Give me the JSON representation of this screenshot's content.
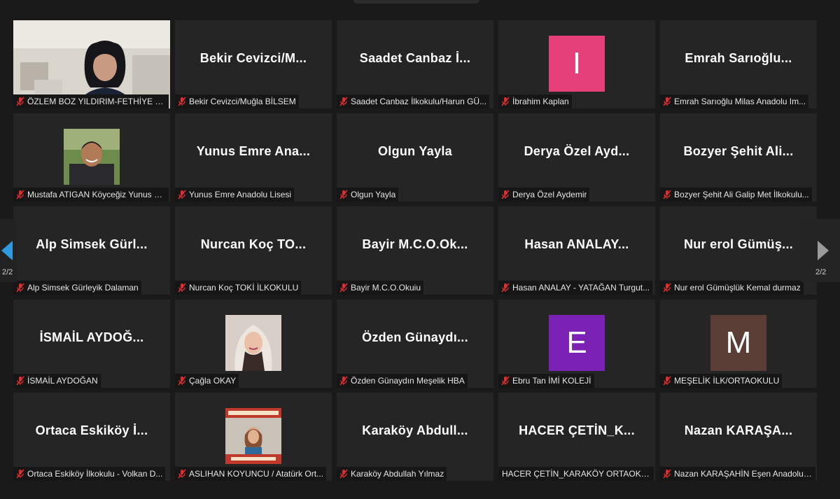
{
  "page": {
    "left_indicator": "2/2",
    "right_indicator": "2/2"
  },
  "colors": {
    "background": "#1a1a1a",
    "tile": "#252525",
    "muted_icon": "#e02d2d",
    "nav_arrow_active": "#2d9be0",
    "nav_arrow_inactive": "#9a9a9a"
  },
  "participants": [
    {
      "type": "video",
      "name": "ÖZLEM BOZ YILDIRIM-FETHİYE BE...",
      "muted": true
    },
    {
      "type": "name",
      "display": "Bekir  Cevizci/M...",
      "name": "Bekir Cevizci/Muğla BİLSEM",
      "muted": true
    },
    {
      "type": "name",
      "display": "Saadet Canbaz İ...",
      "name": "Saadet Canbaz İlkokulu/Harun GÜ...",
      "muted": true
    },
    {
      "type": "avatar",
      "initial": "I",
      "color": "#e5407a",
      "name": "İbrahim Kaplan",
      "muted": true
    },
    {
      "type": "name",
      "display": "Emrah Sarıoğlu...",
      "name": "Emrah Sarıoğlu Milas Anadolu Im...",
      "muted": true
    },
    {
      "type": "photo",
      "photo": "man",
      "name": "Mustafa ATIGAN Köyceğiz Yunus E...",
      "muted": true
    },
    {
      "type": "name",
      "display": "Yunus Emre Ana...",
      "name": "Yunus Emre Anadolu Lisesi",
      "muted": true
    },
    {
      "type": "name",
      "display": "Olgun Yayla",
      "name": "Olgun Yayla",
      "muted": true
    },
    {
      "type": "name",
      "display": "Derya Özel Ayd...",
      "name": "Derya Özel Aydemir",
      "muted": true
    },
    {
      "type": "name",
      "display": "Bozyer Şehit Ali...",
      "name": "Bozyer Şehit Ali Galip Met İlkokulu...",
      "muted": true
    },
    {
      "type": "name",
      "display": "Alp Simsek Gürl...",
      "name": "Alp Simsek Gürleyik Dalaman",
      "muted": true
    },
    {
      "type": "name",
      "display": "Nurcan Koç TO...",
      "name": "Nurcan Koç TOKİ İLKOKULU",
      "muted": true
    },
    {
      "type": "name",
      "display": "Bayir  M.C.O.Ok...",
      "name": "Bayir M.C.O.Okuiu",
      "muted": true
    },
    {
      "type": "name",
      "display": "Hasan  ANALAY...",
      "name": "Hasan ANALAY - YATAĞAN Turgut...",
      "muted": true
    },
    {
      "type": "name",
      "display": "Nur erol Gümüş...",
      "name": "Nur erol Gümüşlük Kemal durmaz",
      "muted": true
    },
    {
      "type": "name",
      "display": "İSMAİL  AYDOĞ...",
      "name": "İSMAİL AYDOĞAN",
      "muted": true
    },
    {
      "type": "photo",
      "photo": "woman",
      "name": "Çağla OKAY",
      "muted": true
    },
    {
      "type": "name",
      "display": "Özden Günaydı...",
      "name": "Özden Günaydın Meşelik HBA",
      "muted": true
    },
    {
      "type": "avatar",
      "initial": "E",
      "color": "#7b22b5",
      "name": "Ebru Tan İMİ KOLEJİ",
      "muted": true
    },
    {
      "type": "avatar",
      "initial": "M",
      "color": "#5a3e36",
      "name": "MEŞELİK İLK/ORTAOKULU",
      "muted": true
    },
    {
      "type": "name",
      "display": "Ortaca Eskiköy İ...",
      "name": "Ortaca Eskiköy İlkokulu - Volkan D...",
      "muted": true
    },
    {
      "type": "photo",
      "photo": "poster",
      "name": "ASLIHAN KOYUNCU / Atatürk Ort...",
      "muted": true
    },
    {
      "type": "name",
      "display": "Karaköy  Abdull...",
      "name": "Karaköy Abdullah Yılmaz",
      "muted": true
    },
    {
      "type": "name",
      "display": "HACER  ÇETİN_K...",
      "name": "HACER ÇETİN_KARAKÖY ORTAOKULU",
      "muted": false
    },
    {
      "type": "name",
      "display": "Nazan  KARAŞA...",
      "name": "Nazan KARAŞAHİN Eşen Anadolu ...",
      "muted": true
    }
  ]
}
